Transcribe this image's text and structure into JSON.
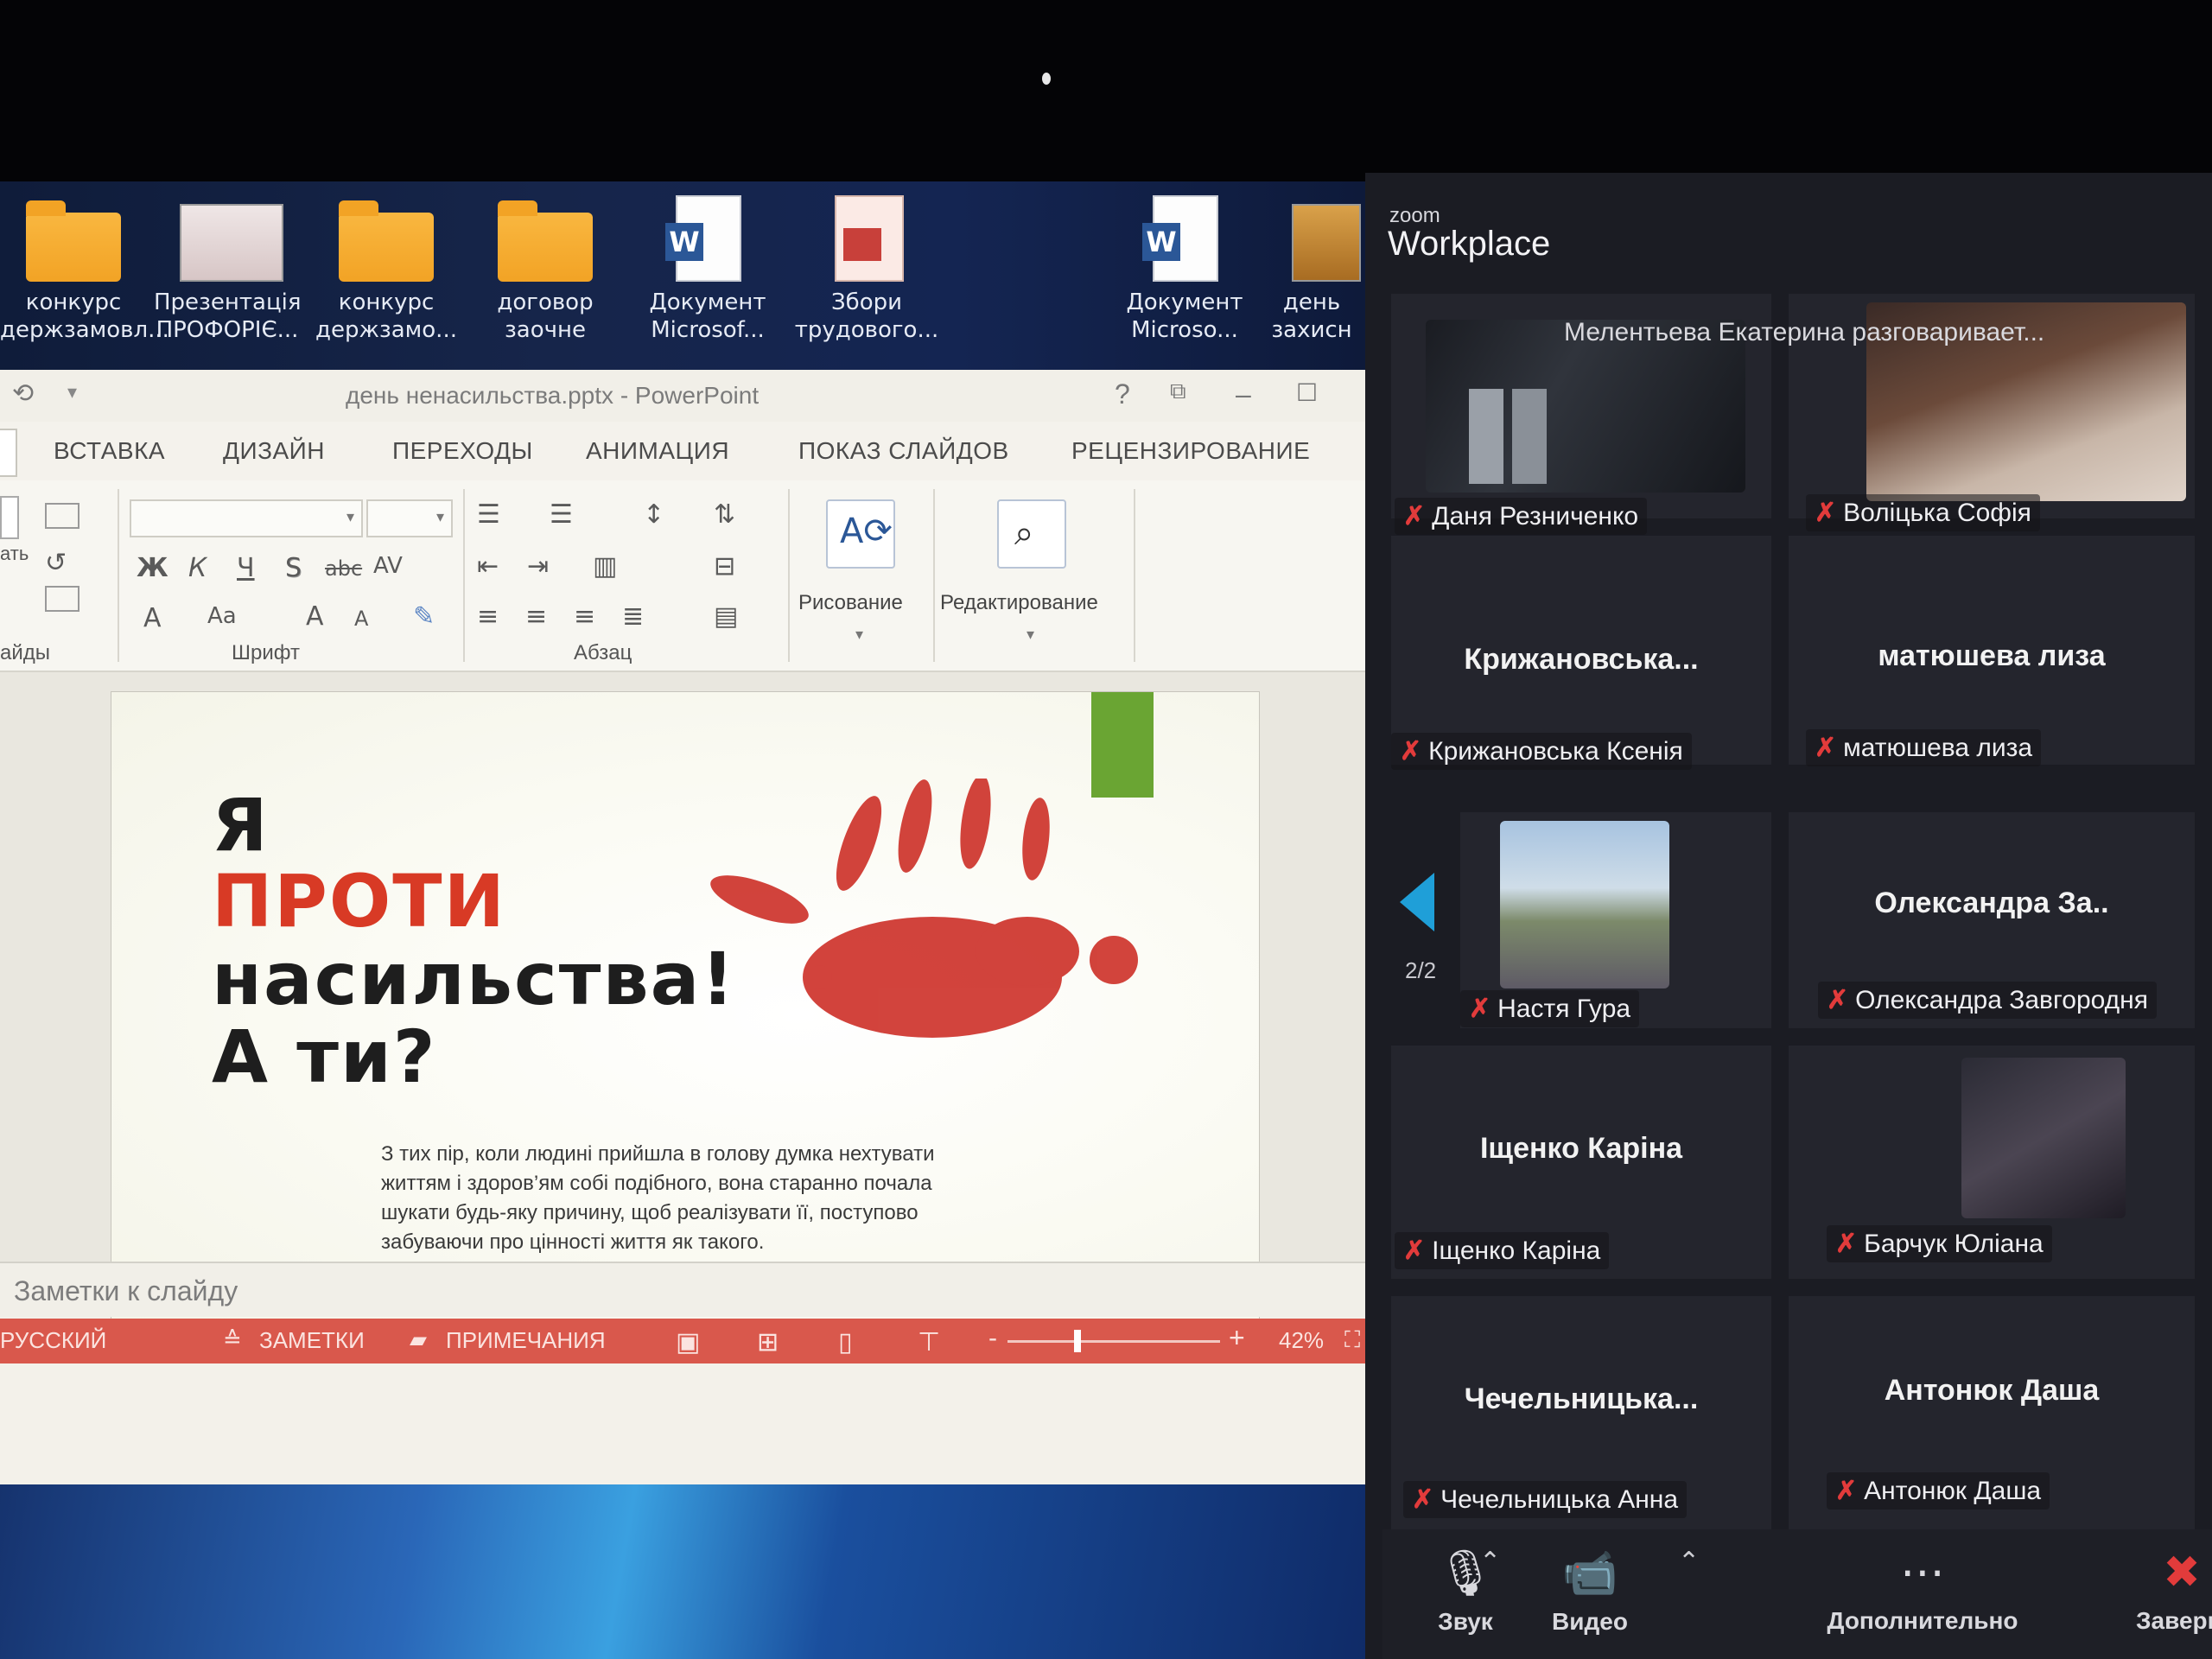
{
  "desktop": {
    "icons": [
      {
        "line1": "конкурс",
        "line2": "держзамовл..."
      },
      {
        "line1": "Презентація",
        "line2": "ПРОФОРІЄ..."
      },
      {
        "line1": "конкурс",
        "line2": "держзамо..."
      },
      {
        "line1": "договор",
        "line2": "заочне"
      },
      {
        "line1": "Документ",
        "line2": "Microsof..."
      },
      {
        "line1": "Збори",
        "line2": "трудового..."
      },
      {
        "line1": "Документ",
        "line2": "Microso..."
      },
      {
        "line1": "день",
        "line2": "захисн"
      }
    ]
  },
  "ppt": {
    "title": "день ненасильства.pptx - PowerPoint",
    "help": "?",
    "tabs": [
      "ВСТАВКА",
      "ДИЗАЙН",
      "ПЕРЕХОДЫ",
      "АНИМАЦИЯ",
      "ПОКАЗ СЛАЙДОВ",
      "РЕЦЕНЗИРОВАНИЕ"
    ],
    "ribbon": {
      "slides_label_a": "ать",
      "slides_label_b": "айды",
      "font_group": "Шрифт",
      "paragraph_group": "Абзац",
      "drawing": "Рисование",
      "editing": "Редактирование",
      "bold": "Ж",
      "italic": "К",
      "underline": "Ч",
      "strike": "S",
      "abc": "abc",
      "av": "AV",
      "font_color": "A",
      "font_case": "Aa",
      "grow": "A",
      "shrink": "A"
    },
    "slide": {
      "line1": "Я",
      "line2": "ПРОТИ",
      "line3": "насильства!",
      "line4": "А ти?",
      "body": "З тих пір, коли людині прийшла в голову думка нехтувати життям і здоров’ям собі подібного, вона старанно почала шукати будь-яку причину, щоб реалізувати її, поступово забуваючи про цінності життя як такого."
    },
    "notes_placeholder": "Заметки к слайду",
    "status": {
      "language": "РУССКИЙ",
      "notes": "ЗАМЕТКИ",
      "comments": "ПРИМЕЧАНИЯ",
      "zoom_minus": "-",
      "zoom_plus": "+",
      "zoom_level": "42%",
      "zoom_fraction": 0.42
    }
  },
  "zoom": {
    "brand_small": "zoom",
    "brand": "Workplace",
    "speaking": "Мелентьева Екатерина разговаривает...",
    "participants": [
      {
        "tag": "Даня Резниченко",
        "big": ""
      },
      {
        "tag": "Воліцька Софія",
        "big": ""
      },
      {
        "tag": "Крижановська Ксенія",
        "big": "Крижановська..."
      },
      {
        "tag": "матюшева лиза",
        "big": "матюшева лиза"
      },
      {
        "tag": "Настя Гура",
        "big": ""
      },
      {
        "tag": "Олександра Завгородня",
        "big": "Олександра За.."
      },
      {
        "tag": "Іщенко Каріна",
        "big": "Іщенко Каріна"
      },
      {
        "tag": "Барчук Юліана",
        "big": ""
      },
      {
        "tag": "Чечельницька Анна",
        "big": "Чечельницька..."
      },
      {
        "tag": "Антонюк Даша",
        "big": "Антонюк Даша"
      }
    ],
    "page": "2/2",
    "toolbar": {
      "audio": "Звук",
      "video": "Видео",
      "more": "Дополнительно",
      "end": "Заверш"
    },
    "colors": {
      "mute": "#e23b3b",
      "accent": "#1f9fd8",
      "panel": "#1b1c23"
    }
  }
}
